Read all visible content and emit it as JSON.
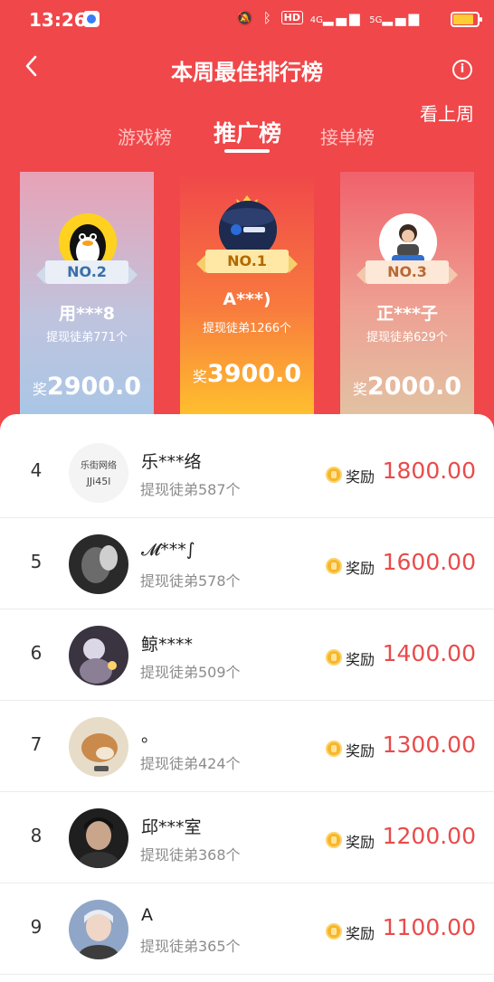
{
  "status_bar": {
    "time": "13:26",
    "hd": "HD",
    "signal": "4G",
    "signal2": "5G"
  },
  "header": {
    "title": "本周最佳排行榜",
    "info_icon": "i",
    "last_week": "看上周"
  },
  "tabs": [
    {
      "label": "游戏榜"
    },
    {
      "label": "推广榜"
    },
    {
      "label": "接单榜"
    }
  ],
  "podium": {
    "second": {
      "rank": "NO.2",
      "name": "用***8",
      "sub": "提现徒弟771个",
      "reward_prefix": "奖",
      "reward": "2900.0"
    },
    "first": {
      "rank": "NO.1",
      "name": "A***)",
      "sub": "提现徒弟1266个",
      "reward_prefix": "奖",
      "reward": "3900.0"
    },
    "third": {
      "rank": "NO.3",
      "name": "正***子",
      "sub": "提现徒弟629个",
      "reward_prefix": "奖",
      "reward": "2000.0"
    }
  },
  "list": {
    "reward_label": "奖励",
    "rows": [
      {
        "rank": "4",
        "name": "乐***络",
        "sub": "提现徒弟587个",
        "amount": "1800.00",
        "logo_line1": "乐街网络",
        "logo_line2": "JJi45l"
      },
      {
        "rank": "5",
        "name": "𝓜***∫",
        "sub": "提现徒弟578个",
        "amount": "1600.00"
      },
      {
        "rank": "6",
        "name": "鲸****",
        "sub": "提现徒弟509个",
        "amount": "1400.00"
      },
      {
        "rank": "7",
        "name": "。",
        "sub": "提现徒弟424个",
        "amount": "1300.00"
      },
      {
        "rank": "8",
        "name": "邱***室",
        "sub": "提现徒弟368个",
        "amount": "1200.00"
      },
      {
        "rank": "9",
        "name": "A",
        "sub": "提现徒弟365个",
        "amount": "1100.00"
      }
    ]
  }
}
